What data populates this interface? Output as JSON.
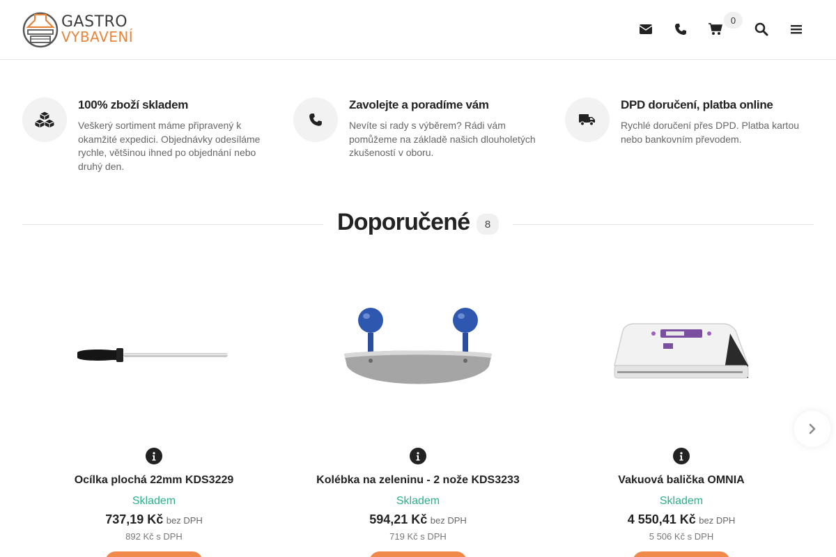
{
  "header": {
    "logo": {
      "line1": "GASTRO",
      "line2": "VYBAVENÍ"
    },
    "icons": [
      "envelope-icon",
      "phone-icon",
      "cart-icon",
      "search-icon",
      "menu-icon"
    ],
    "cart_count": "0"
  },
  "features": [
    {
      "icon": "boxes-icon",
      "title": "100% zboží skladem",
      "text": "Veškerý sortiment máme připravený k okamžité expedici. Objednávky odesíláme rychle, většinou ihned po objednání nebo druhý den."
    },
    {
      "icon": "phone-icon",
      "title": "Zavolejte a poradíme vám",
      "text": "Nevíte si rady s výběrem? Rádi vám pomůžeme na základě našich dlouholetých zkušeností v oboru."
    },
    {
      "icon": "truck-icon",
      "title": "DPD doručení, platba online",
      "text": "Rychlé doručení přes DPD. Platba kartou nebo bankovním převodem."
    }
  ],
  "section": {
    "title": "Doporučené",
    "count": "8"
  },
  "products": [
    {
      "name": "Ocílka plochá 22mm KDS3229",
      "stock": "Skladem",
      "price": "737,19 Kč",
      "price_note": "bez DPH",
      "price_vat": "892 Kč s DPH"
    },
    {
      "name": "Kolébka na zeleninu - 2 nože KDS3233",
      "stock": "Skladem",
      "price": "594,21 Kč",
      "price_note": "bez DPH",
      "price_vat": "719 Kč s DPH"
    },
    {
      "name": "Vakuová balička OMNIA",
      "stock": "Skladem",
      "price": "4 550,41 Kč",
      "price_note": "bez DPH",
      "price_vat": "5 506 Kč s DPH"
    }
  ],
  "colors": {
    "accent": "#f08a4b",
    "stock": "#2bb08a",
    "dark": "#222222"
  }
}
